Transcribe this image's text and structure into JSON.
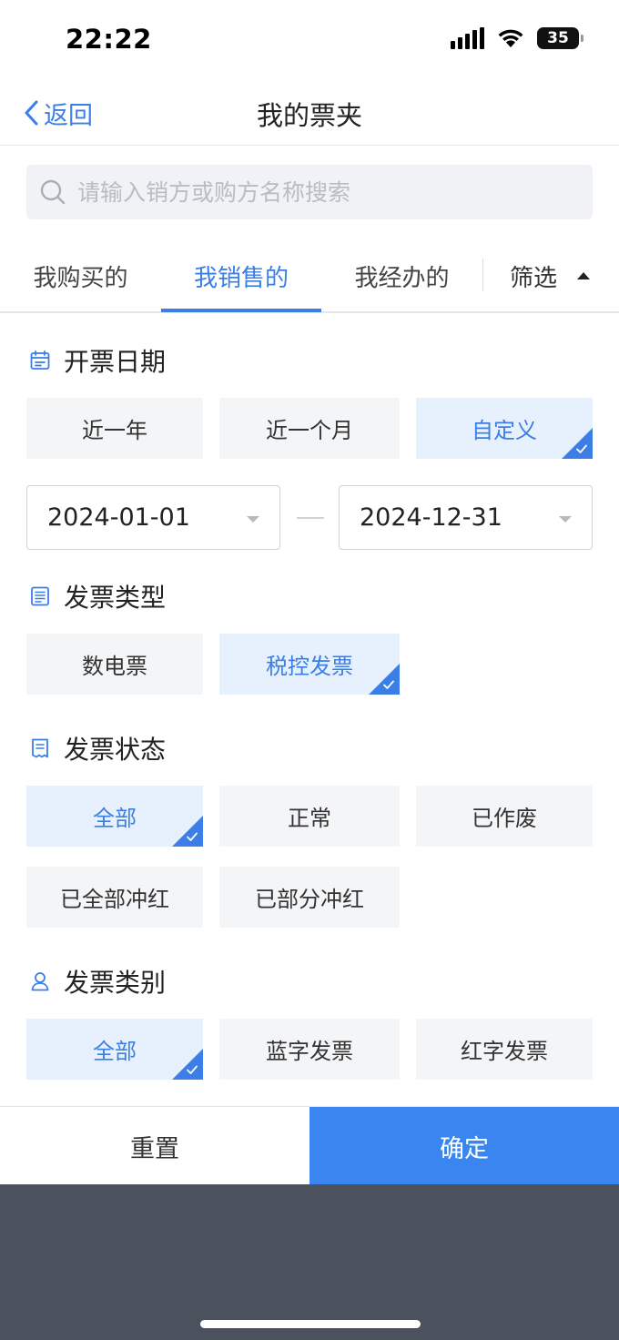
{
  "status_bar": {
    "time": "22:22",
    "battery": "35"
  },
  "nav": {
    "back_label": "返回",
    "title": "我的票夹"
  },
  "search": {
    "placeholder": "请输入销方或购方名称搜索"
  },
  "tabs": [
    {
      "label": "我购买的",
      "active": false
    },
    {
      "label": "我销售的",
      "active": true
    },
    {
      "label": "我经办的",
      "active": false
    }
  ],
  "filter": {
    "label": "筛选"
  },
  "invoice_date": {
    "title": "开票日期",
    "options": [
      {
        "label": "近一年",
        "selected": false
      },
      {
        "label": "近一个月",
        "selected": false
      },
      {
        "label": "自定义",
        "selected": true
      }
    ],
    "start_date": "2024-01-01",
    "end_date": "2024-12-31"
  },
  "invoice_type": {
    "title": "发票类型",
    "options": [
      {
        "label": "数电票",
        "selected": false
      },
      {
        "label": "税控发票",
        "selected": true
      }
    ]
  },
  "invoice_status": {
    "title": "发票状态",
    "options": [
      {
        "label": "全部",
        "selected": true
      },
      {
        "label": "正常",
        "selected": false
      },
      {
        "label": "已作废",
        "selected": false
      },
      {
        "label": "已全部冲红",
        "selected": false
      },
      {
        "label": "已部分冲红",
        "selected": false
      }
    ]
  },
  "invoice_category": {
    "title": "发票类别",
    "options": [
      {
        "label": "全部",
        "selected": true
      },
      {
        "label": "蓝字发票",
        "selected": false
      },
      {
        "label": "红字发票",
        "selected": false
      }
    ]
  },
  "actions": {
    "reset_label": "重置",
    "confirm_label": "确定"
  },
  "colors": {
    "accent": "#3a7ee6",
    "confirm": "#3a86f0",
    "option_bg": "#f4f5f7",
    "selected_bg": "#e7f1fd",
    "overlay": "#4b525d"
  }
}
